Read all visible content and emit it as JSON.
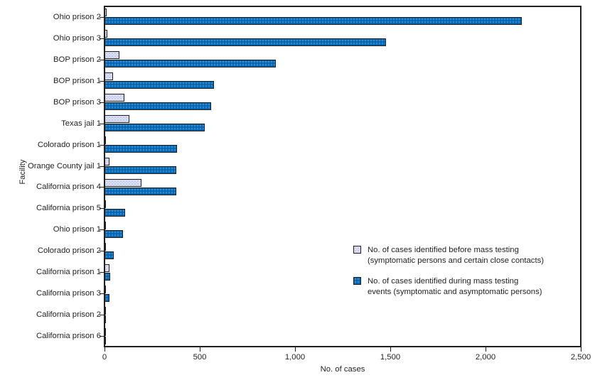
{
  "chart_data": {
    "type": "bar",
    "orientation": "horizontal",
    "title": "",
    "xlabel": "No. of cases",
    "ylabel": "Facility",
    "xlim": [
      0,
      2500
    ],
    "xticks": [
      "0",
      "500",
      "1,000",
      "1,500",
      "2,000",
      "2,500"
    ],
    "xtick_values": [
      0,
      500,
      1000,
      1500,
      2000,
      2500
    ],
    "grid": false,
    "legend_position": "center-right",
    "categories": [
      "Ohio prison 2",
      "Ohio prison 3",
      "BOP prison 2",
      "BOP prison 1",
      "BOP prison 3",
      "Texas jail 1",
      "Colorado prison 1",
      "Orange County jail 1",
      "California prison 4",
      "California prison 5",
      "Ohio prison 1",
      "Colorado prison 2",
      "California prison 1",
      "California prison 3",
      "California prison 2",
      "California prison 6"
    ],
    "series": [
      {
        "name": "No. of cases identified before mass testing (symptomatic persons and certain close contacts)",
        "color": "#dde3f4",
        "values": [
          11,
          16,
          78,
          45,
          104,
          130,
          5,
          27,
          194,
          5,
          2,
          1,
          27,
          2,
          5,
          1
        ]
      },
      {
        "name": "No. of cases identified during mass testing events (symptomatic and asymptomatic persons)",
        "color": "#0b6cb8",
        "values": [
          2190,
          1477,
          898,
          574,
          558,
          526,
          379,
          378,
          375,
          108,
          97,
          48,
          31,
          26,
          7,
          1
        ]
      }
    ]
  },
  "legend": {
    "items": [
      {
        "swatch": "before",
        "label": "No. of cases identified before mass testing\n(symptomatic persons and certain close contacts)"
      },
      {
        "swatch": "during",
        "label": "No. of cases identified during mass testing\nevents (symptomatic and asymptomatic persons)"
      }
    ]
  }
}
